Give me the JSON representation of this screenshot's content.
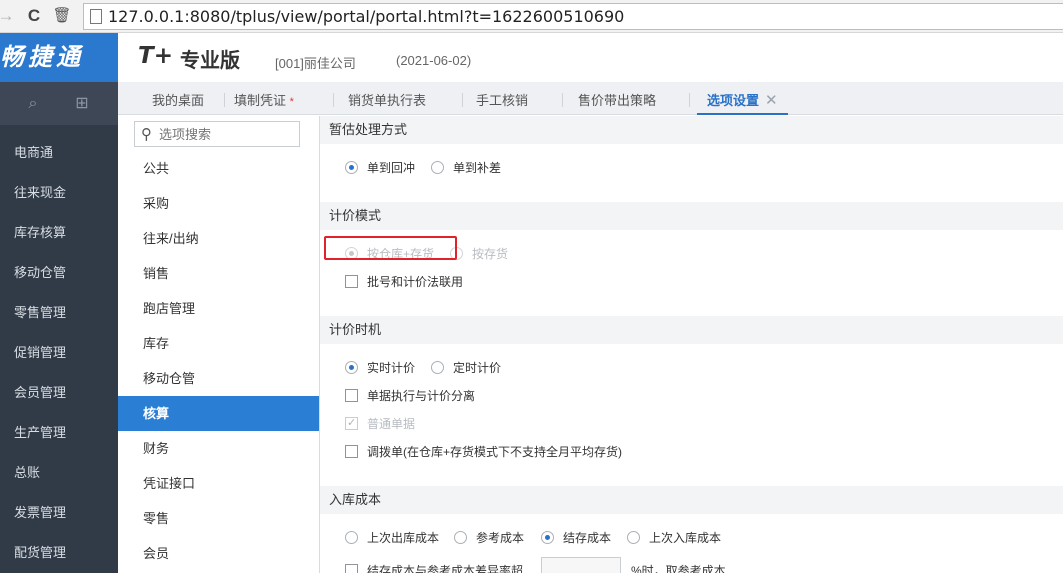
{
  "browser": {
    "url": "127.0.0.1:8080/tplus/view/portal/portal.html?t=1622600510690"
  },
  "sidebar": {
    "brand": "畅捷通",
    "items": [
      "电商通",
      "往来现金",
      "库存核算",
      "移动仓管",
      "零售管理",
      "促销管理",
      "会员管理",
      "生产管理",
      "总账",
      "发票管理",
      "配货管理"
    ]
  },
  "header": {
    "logo_mark": "T+",
    "logo_text": "专业版",
    "company": "[001]丽佳公司",
    "date": "(2021-06-02)"
  },
  "tabs": [
    {
      "label": "我的桌面"
    },
    {
      "label": "填制凭证",
      "mark": "*"
    },
    {
      "label": "销货单执行表"
    },
    {
      "label": "手工核销"
    },
    {
      "label": "售价带出策略"
    },
    {
      "label": "选项设置",
      "close": "✕"
    }
  ],
  "options_nav": {
    "search_placeholder": "选项搜索",
    "categories": [
      "公共",
      "采购",
      "往来/出纳",
      "销售",
      "跑店管理",
      "库存",
      "移动仓管",
      "核算",
      "财务",
      "凭证接口",
      "零售",
      "会员"
    ],
    "active": "核算"
  },
  "content": {
    "sec_estimate": {
      "title": "暂估处理方式",
      "opt1": "单到回冲",
      "opt2": "单到补差"
    },
    "sec_pricing_mode": {
      "title": "计价模式",
      "opt1": "按仓库+存货",
      "opt2": "按存货",
      "check1": "批号和计价法联用"
    },
    "sec_pricing_time": {
      "title": "计价时机",
      "opt1": "实时计价",
      "opt2": "定时计价",
      "check1": "单据执行与计价分离",
      "check2": "普通单据",
      "check3": "调拨单(在仓库+存货模式下不支持全月平均存货)"
    },
    "sec_inbound_cost": {
      "title": "入库成本",
      "opt1": "上次出库成本",
      "opt2": "参考成本",
      "opt3": "结存成本",
      "opt4": "上次入库成本",
      "check1": "结存成本与参考成本差异率超",
      "suffix": "%时，取参考成本"
    }
  },
  "colors": {
    "sidebar_bg": "#313b48",
    "brand_bg": "#2a79cf",
    "accent": "#2a72c8",
    "highlight_box": "#e0232b"
  }
}
